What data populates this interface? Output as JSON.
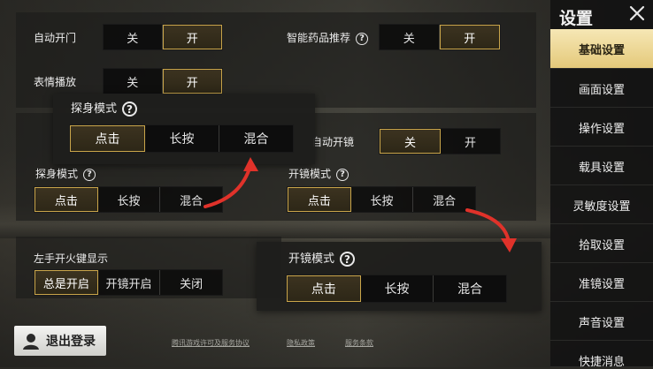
{
  "sidebar": {
    "title": "设置",
    "items": [
      {
        "label": "基础设置",
        "active": true
      },
      {
        "label": "画面设置"
      },
      {
        "label": "操作设置"
      },
      {
        "label": "载具设置"
      },
      {
        "label": "灵敏度设置"
      },
      {
        "label": "拾取设置"
      },
      {
        "label": "准镜设置"
      },
      {
        "label": "声音设置"
      },
      {
        "label": "快捷消息"
      }
    ]
  },
  "settings": {
    "auto_door": {
      "label": "自动开门",
      "options": [
        "关",
        "开"
      ],
      "selected": "开"
    },
    "smart_med": {
      "label": "智能药品推荐",
      "options": [
        "关",
        "开"
      ],
      "selected": "开"
    },
    "emote": {
      "label": "表情播放",
      "options": [
        "关",
        "开"
      ],
      "selected": "开"
    },
    "auto_scope": {
      "label": "自动开镜",
      "options": [
        "关",
        "开"
      ],
      "selected": "关"
    },
    "peek_mode": {
      "label": "探身模式",
      "options": [
        "点击",
        "长按",
        "混合"
      ],
      "selected": "点击"
    },
    "scope_mode": {
      "label": "开镜模式",
      "options": [
        "点击",
        "长按",
        "混合"
      ],
      "selected": "点击"
    },
    "left_fire": {
      "label": "左手开火键显示",
      "options": [
        "总是开启",
        "开镜开启",
        "关闭"
      ],
      "selected": "总是开启"
    }
  },
  "popups": {
    "peek": {
      "label": "探身模式",
      "options": [
        "点击",
        "长按",
        "混合"
      ],
      "selected": "点击"
    },
    "scope": {
      "label": "开镜模式",
      "options": [
        "点击",
        "长按",
        "混合"
      ],
      "selected": "点击"
    }
  },
  "logout_label": "退出登录",
  "footer": {
    "license": "腾讯游戏许可及服务协议",
    "privacy": "隐私政策",
    "terms": "服务条款"
  },
  "colors": {
    "accent_gold": "#c9a54a",
    "active_tab": "#e4c97a",
    "arrow_red": "#e0322a"
  }
}
